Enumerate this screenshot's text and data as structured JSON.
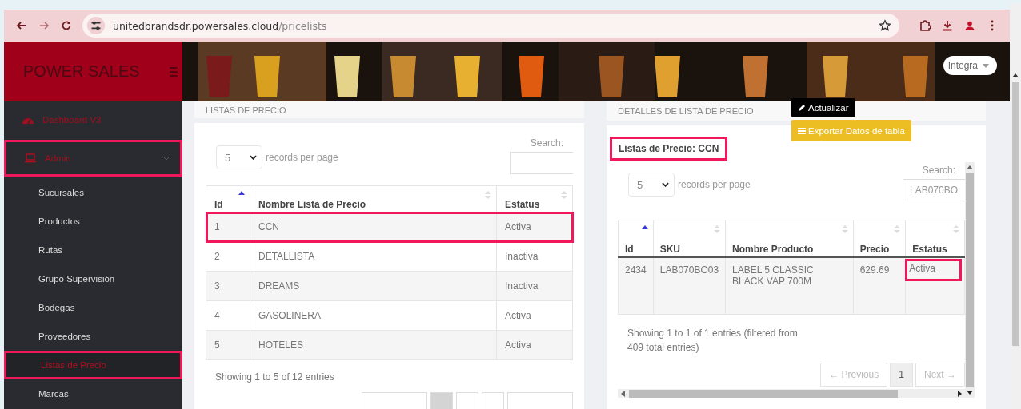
{
  "browser": {
    "url_host": "unitedbrandsdr.powersales.cloud",
    "url_path": "/pricelists"
  },
  "brand": "POWER SALES",
  "user_menu": "Integra",
  "sidebar": {
    "items": [
      {
        "label": "Dashboard V3",
        "kind": "link",
        "highlighted": false,
        "selected": false
      },
      {
        "label": "Admin",
        "kind": "group",
        "expanded": true,
        "highlighted": true,
        "selected": false,
        "children": [
          {
            "label": "Sucursales",
            "selected": false,
            "highlighted": false
          },
          {
            "label": "Productos",
            "selected": false,
            "highlighted": false
          },
          {
            "label": "Rutas",
            "selected": false,
            "highlighted": false
          },
          {
            "label": "Grupo Supervisión",
            "selected": false,
            "highlighted": false
          },
          {
            "label": "Bodegas",
            "selected": false,
            "highlighted": false
          },
          {
            "label": "Proveedores",
            "selected": false,
            "highlighted": false
          },
          {
            "label": "Listas de Precio",
            "selected": true,
            "highlighted": true
          },
          {
            "label": "Marcas",
            "selected": false,
            "highlighted": false
          }
        ]
      }
    ]
  },
  "price_lists": {
    "title": "LISTAS DE PRECIO",
    "length": "5",
    "length_label": "records per page",
    "search_label": "Search:",
    "columns": [
      {
        "label": "Id",
        "sorted": true
      },
      {
        "label": "Nombre Lista de Precio",
        "sorted": false
      },
      {
        "label": "Estatus",
        "sorted": false
      }
    ],
    "rows": [
      {
        "cells": [
          "1",
          "CCN",
          "Activa"
        ],
        "highlighted": true
      },
      {
        "cells": [
          "2",
          "DETALLISTA",
          "Inactiva"
        ],
        "highlighted": false
      },
      {
        "cells": [
          "3",
          "DREAMS",
          "Inactiva"
        ],
        "highlighted": false
      },
      {
        "cells": [
          "4",
          "GASOLINERA",
          "Activa"
        ],
        "highlighted": false
      },
      {
        "cells": [
          "5",
          "HOTELES",
          "Activa"
        ],
        "highlighted": false
      }
    ],
    "info": "Showing 1 to 5 of 12 entries",
    "pagination": [
      {
        "kind": "prev",
        "selected": false
      },
      {
        "kind": "page",
        "selected": true
      },
      {
        "kind": "page",
        "selected": false
      },
      {
        "kind": "page",
        "selected": false
      },
      {
        "kind": "next",
        "selected": false
      }
    ]
  },
  "details": {
    "title": "DETALLES DE LISTA DE PRECIO",
    "actions": [
      {
        "label": "Actualizar",
        "kind": "dark"
      },
      {
        "label": "Exportar Datos de tabla",
        "kind": "warning"
      }
    ],
    "subtitle": "Listas de Precio: CCN",
    "subtitle_highlighted": true,
    "length": "5",
    "length_label": "records per page",
    "search_label": "Search:",
    "search_value": "LAB070BO",
    "columns": [
      {
        "label": "Id",
        "sorted": true
      },
      {
        "label": "SKU",
        "sorted": false
      },
      {
        "label": "Nombre Producto",
        "sorted": false
      },
      {
        "label": "Precio",
        "sorted": false
      },
      {
        "label": "Estatus",
        "sorted": false
      }
    ],
    "rows": [
      {
        "cells": [
          {
            "text": "2434",
            "highlighted": false
          },
          {
            "text": "LAB070BO03",
            "highlighted": false
          },
          {
            "text": "LABEL 5 CLASSIC BLACK VAP 700M",
            "highlighted": false
          },
          {
            "text": "629.69",
            "highlighted": false
          },
          {
            "text": "Activa",
            "highlighted": true
          }
        ]
      }
    ],
    "info": "Showing 1 to 1 of 1 entries (filtered from 409 total entries)",
    "pagination": [
      {
        "label": "← Previous",
        "disabled": true,
        "selected": false
      },
      {
        "label": "1",
        "disabled": false,
        "selected": true
      },
      {
        "label": "Next →",
        "disabled": true,
        "selected": false
      }
    ]
  }
}
